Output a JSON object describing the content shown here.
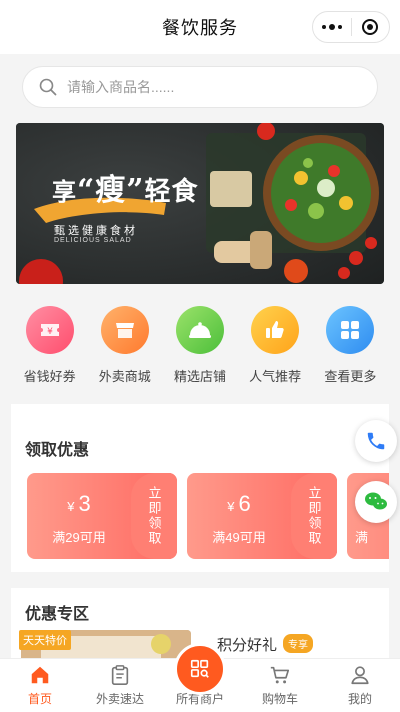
{
  "header": {
    "title": "餐饮服务"
  },
  "search": {
    "placeholder": "请输入商品名......"
  },
  "banner": {
    "headline": "“享”瘦”轻食",
    "headline_parts": [
      "享",
      "“瘦”",
      "轻食"
    ],
    "subtitle": "甄选健康食材",
    "subtitle_en": "DELICIOUS SALAD"
  },
  "categories": [
    {
      "label": "省钱好券",
      "icon": "coupon-icon",
      "color_from": "#ff8fa3",
      "color_to": "#ff4d6d"
    },
    {
      "label": "外卖商城",
      "icon": "shop-icon",
      "color_from": "#ffb26b",
      "color_to": "#ff7a2e"
    },
    {
      "label": "精选店铺",
      "icon": "cloche-icon",
      "color_from": "#9be26a",
      "color_to": "#4cbf3a"
    },
    {
      "label": "人气推荐",
      "icon": "thumbs-up-icon",
      "color_from": "#ffd24d",
      "color_to": "#ffa31a"
    },
    {
      "label": "查看更多",
      "icon": "grid-icon",
      "color_from": "#6cc4ff",
      "color_to": "#2e8cf0"
    }
  ],
  "coupons_section": {
    "title": "领取优惠",
    "coupons": [
      {
        "currency": "¥",
        "amount": "3",
        "condition": "满29可用",
        "claim": "立即领取"
      },
      {
        "currency": "¥",
        "amount": "6",
        "condition": "满49可用",
        "claim": "立即领取"
      },
      {
        "currency": "",
        "amount": "",
        "condition": "满",
        "claim": ""
      }
    ]
  },
  "promo_section": {
    "title": "优惠专区",
    "tag": "天天特价",
    "item_name": "积分好礼",
    "exclusive_badge": "专享"
  },
  "floating": {
    "phone_icon": "phone-icon",
    "wechat_icon": "wechat-icon"
  },
  "tabbar": [
    {
      "label": "首页",
      "icon": "home-icon",
      "active": true
    },
    {
      "label": "外卖速达",
      "icon": "clipboard-icon",
      "active": false
    },
    {
      "label": "所有商户",
      "icon": "store-search-icon",
      "active": false
    },
    {
      "label": "购物车",
      "icon": "cart-icon",
      "active": false
    },
    {
      "label": "我的",
      "icon": "user-icon",
      "active": false
    }
  ],
  "colors": {
    "accent": "#ff5a1f",
    "coupon": "#ff6a62",
    "badge": "#f5a623"
  }
}
